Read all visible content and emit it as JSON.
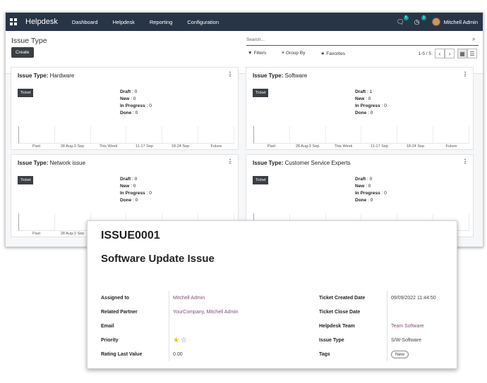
{
  "navbar": {
    "brand": "Helpdesk",
    "menus": [
      "Dashboard",
      "Helpdesk",
      "Reporting",
      "Configuration"
    ],
    "chat_badge": "5",
    "activity_badge": "3",
    "user": "Mitchell Admin"
  },
  "control_panel": {
    "title": "Issue Type",
    "create_label": "Create",
    "search_placeholder": "Search...",
    "filters_label": "Filters",
    "groupby_label": "Group By",
    "favorites_label": "Favorites",
    "pager": "1-5 / 5"
  },
  "cards": [
    {
      "title_label": "Issue Type:",
      "title": "Hardware",
      "tag": "Ticket",
      "draft": "Draft",
      "draft_v": ": 0",
      "new": "New",
      "new_v": ": 0",
      "progress": "In Progress",
      "progress_v": ": 0",
      "done": "Done",
      "done_v": ": 0"
    },
    {
      "title_label": "Issue Type:",
      "title": "Software",
      "tag": "Ticket",
      "draft": "Draft",
      "draft_v": ": 1",
      "new": "New",
      "new_v": ": 0",
      "progress": "In Progress",
      "progress_v": ": 0",
      "done": "Done",
      "done_v": ": 0"
    },
    {
      "title_label": "Issue Type:",
      "title": "Network issue",
      "tag": "Ticket",
      "draft": "Draft",
      "draft_v": ": 0",
      "new": "New",
      "new_v": ": 0",
      "progress": "In Progress",
      "progress_v": ": 0",
      "done": "Done",
      "done_v": ": 0"
    },
    {
      "title_label": "Issue Type:",
      "title": "Customer Service Experts",
      "tag": "Ticket",
      "draft": "Draft",
      "draft_v": ": 0",
      "new": "New",
      "new_v": ": 0",
      "progress": "In Progress",
      "progress_v": ": 0",
      "done": "Done",
      "done_v": ": 0"
    }
  ],
  "timeline_labels": [
    "Past",
    "28 Aug-3 Sep",
    "This Week",
    "11-17 Sep",
    "18-24 Sep",
    "Future"
  ],
  "ticket": {
    "reference": "ISSUE0001",
    "name": "Software Update Issue",
    "left_fields": [
      {
        "label": "Assigned to",
        "value": "Mitchell Admin"
      },
      {
        "label": "Related Partner",
        "value": "YourCompany, Mitchell Admin"
      },
      {
        "label": "Email",
        "value": ""
      },
      {
        "label": "Priority",
        "value": ""
      },
      {
        "label": "Rating Last Value",
        "value": "0.00"
      }
    ],
    "priority_stars": 1,
    "right_fields": [
      {
        "label": "Ticket Created Date",
        "value": "09/09/2022 11:44:50"
      },
      {
        "label": "Ticket Close Date",
        "value": ""
      },
      {
        "label": "Helpdesk Team",
        "value": "Team Software"
      },
      {
        "label": "Issue Type",
        "value": "S/W-Software"
      },
      {
        "label": "Tags",
        "value": "New"
      }
    ]
  },
  "colors": {
    "navbar": "#283546",
    "link": "#7c5374",
    "star": "#f3c200"
  }
}
